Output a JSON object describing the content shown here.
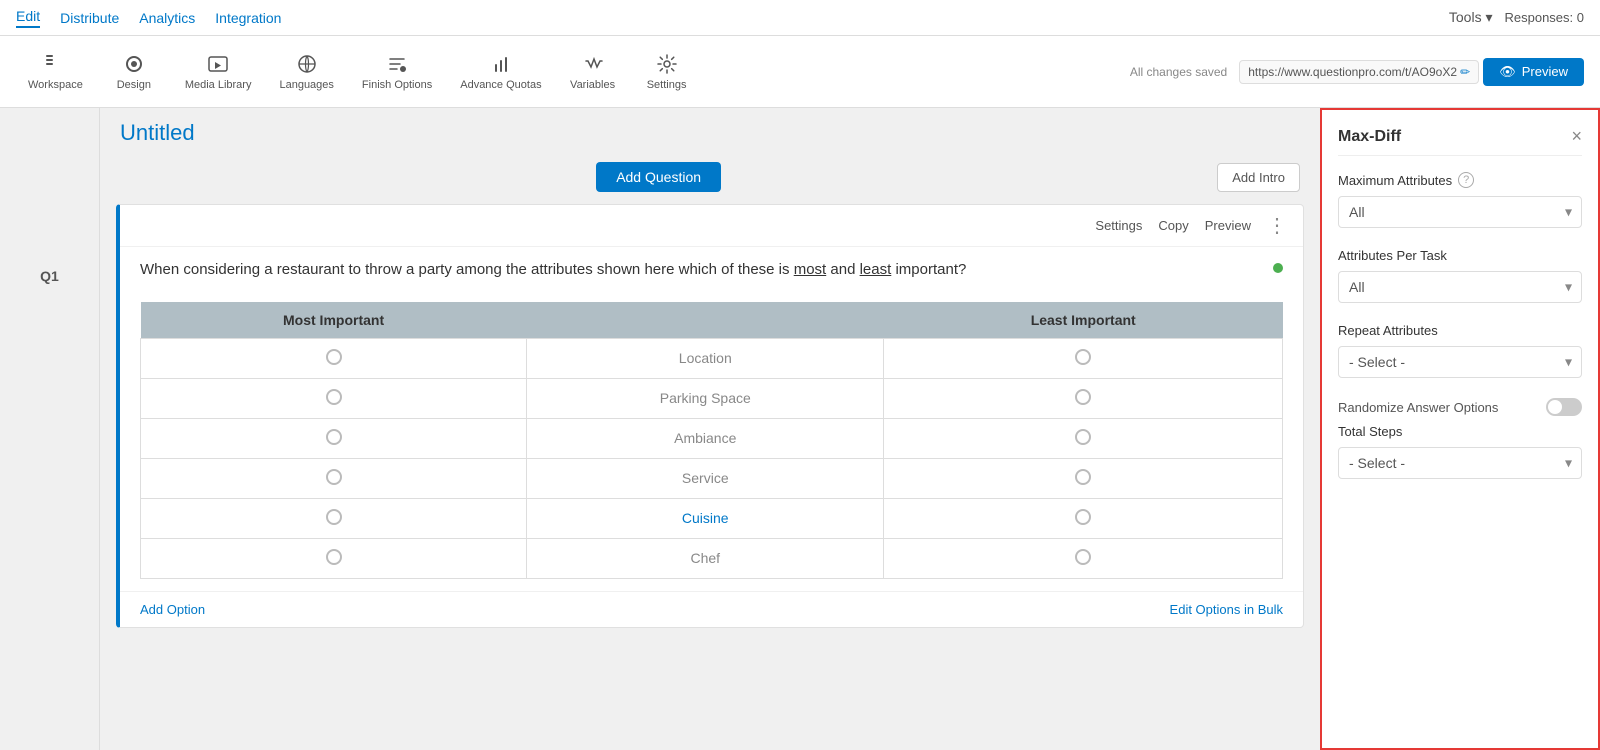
{
  "topnav": {
    "edit": "Edit",
    "distribute": "Distribute",
    "analytics": "Analytics",
    "integration": "Integration",
    "tools": "Tools ▾",
    "responses": "Responses: 0"
  },
  "toolbar": {
    "workspace": "Workspace",
    "design": "Design",
    "media_library": "Media Library",
    "languages": "Languages",
    "finish_options": "Finish Options",
    "advance_quotas": "Advance Quotas",
    "variables": "Variables",
    "settings": "Settings",
    "all_changes_saved": "All changes saved",
    "url": "https://www.questionpro.com/t/AO9oX2",
    "preview": "Preview"
  },
  "survey": {
    "title": "Untitled",
    "add_question_btn": "Add Question",
    "add_intro_btn": "Add Intro"
  },
  "question": {
    "label": "Q1",
    "settings_link": "Settings",
    "copy_link": "Copy",
    "preview_link": "Preview",
    "text_before": "When considering a restaurant to throw a party among the attributes shown here which of these is",
    "most_word": "most",
    "text_middle": "and",
    "least_word": "least",
    "text_after": "important?",
    "table": {
      "col1_header": "Most Important",
      "col2_header": "Least Important",
      "rows": [
        {
          "attr": "Location"
        },
        {
          "attr": "Parking Space"
        },
        {
          "attr": "Ambiance"
        },
        {
          "attr": "Service"
        },
        {
          "attr": "Cuisine"
        },
        {
          "attr": "Chef"
        }
      ]
    },
    "add_option": "Add Option",
    "edit_bulk": "Edit Options in Bulk"
  },
  "right_panel": {
    "title": "Max-Diff",
    "close_icon": "×",
    "maximum_attributes_label": "Maximum Attributes",
    "maximum_attributes_value": "All",
    "attributes_per_task_label": "Attributes Per Task",
    "attributes_per_task_value": "All",
    "repeat_attributes_label": "Repeat Attributes",
    "repeat_attributes_value": "- Select -",
    "randomize_label": "Randomize Answer Options",
    "total_steps_label": "Total Steps",
    "total_steps_value": "- Select -"
  }
}
